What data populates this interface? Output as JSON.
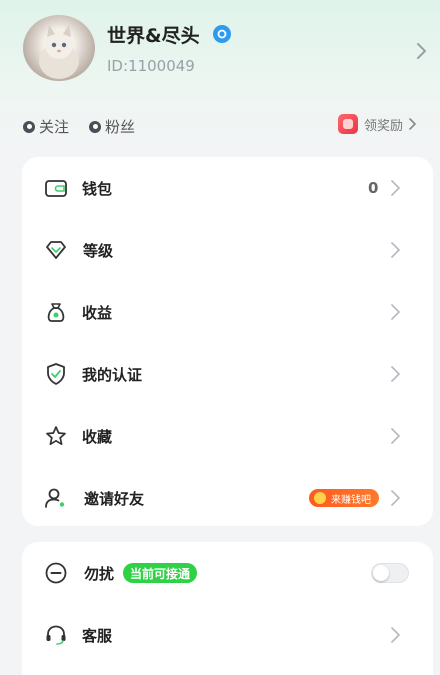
{
  "profile": {
    "username": "世界&尽头",
    "user_id": "ID:1100049"
  },
  "social": {
    "following_label": "关注",
    "fans_label": "粉丝",
    "reward_label": "领奖励"
  },
  "menu": {
    "wallet": {
      "label": "钱包",
      "value": "0"
    },
    "level": {
      "label": "等级"
    },
    "earnings": {
      "label": "收益"
    },
    "verification": {
      "label": "我的认证"
    },
    "favorites": {
      "label": "收藏"
    },
    "invite": {
      "label": "邀请好友",
      "badge": "来赚钱吧"
    }
  },
  "settings": {
    "dnd": {
      "label": "勿扰",
      "status": "当前可接通",
      "enabled": false
    },
    "support": {
      "label": "客服"
    }
  },
  "colors": {
    "accent_green": "#2fd146",
    "verified_blue": "#2c9bf0",
    "invite_orange": "#ff5a1f"
  },
  "icons": {
    "verified": "verified-icon",
    "wallet": "wallet-icon",
    "level": "diamond-icon",
    "earnings": "money-bag-icon",
    "verification": "shield-check-icon",
    "favorites": "star-icon",
    "invite": "add-user-icon",
    "dnd": "minus-circle-icon",
    "support": "headset-icon"
  }
}
